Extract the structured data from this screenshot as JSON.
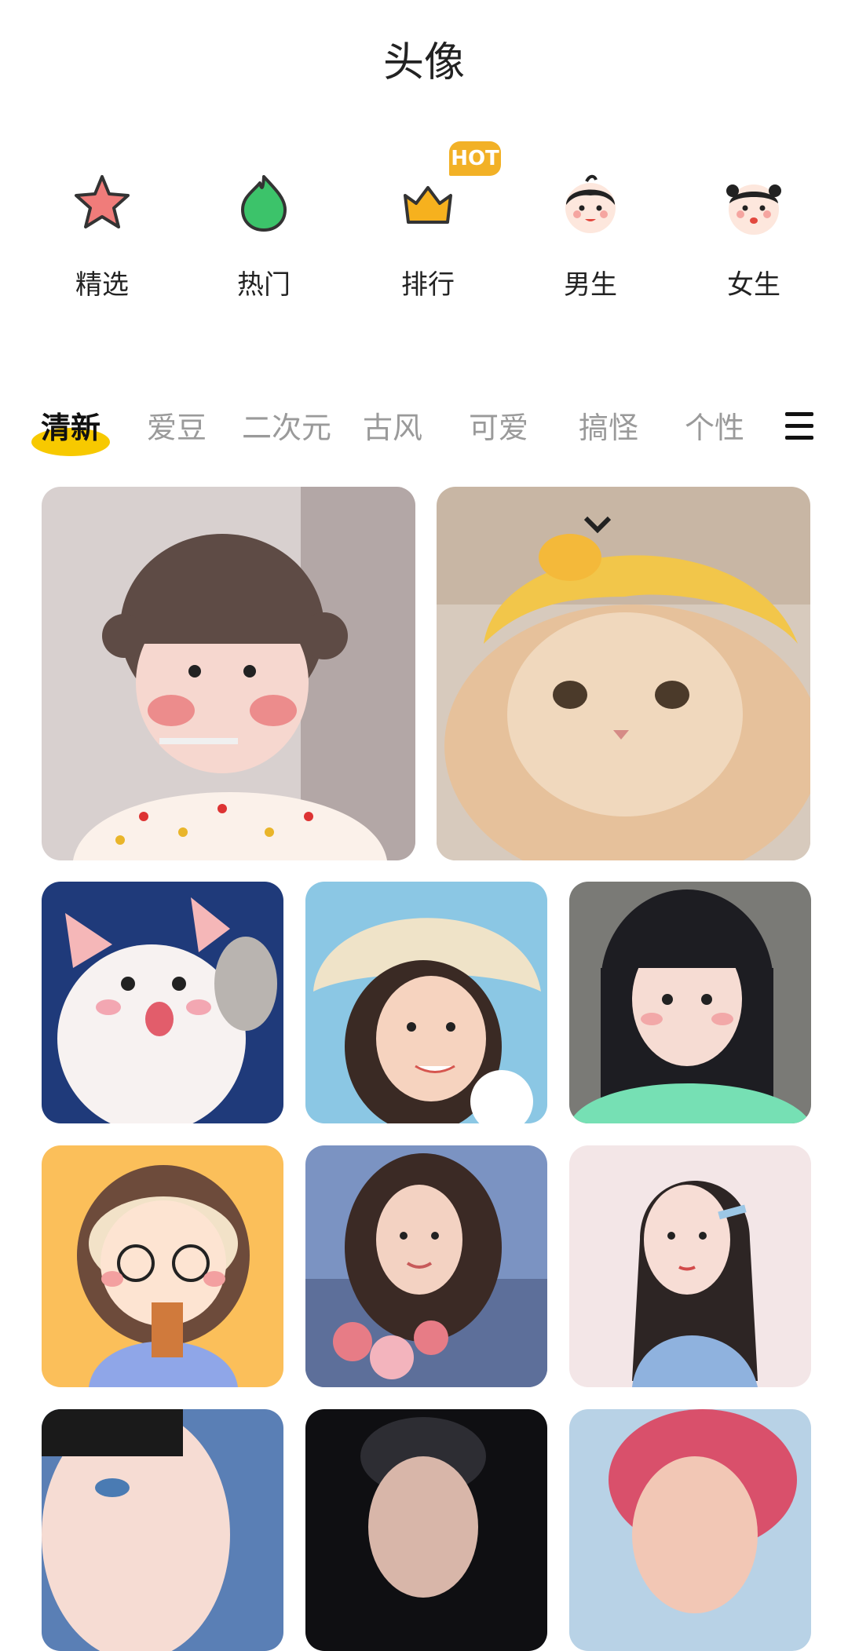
{
  "header": {
    "title": "头像"
  },
  "categories": [
    {
      "label": "精选",
      "icon": "star-icon"
    },
    {
      "label": "热门",
      "icon": "flame-icon"
    },
    {
      "label": "排行",
      "icon": "crown-icon",
      "badge": "HOT"
    },
    {
      "label": "男生",
      "icon": "boy-face-icon"
    },
    {
      "label": "女生",
      "icon": "girl-face-icon"
    }
  ],
  "tabs": [
    {
      "label": "清新",
      "active": true
    },
    {
      "label": "爱豆"
    },
    {
      "label": "二次元"
    },
    {
      "label": "古风"
    },
    {
      "label": "可爱"
    },
    {
      "label": "搞怪"
    },
    {
      "label": "个性"
    }
  ],
  "menu": {
    "icon": "menu-icon"
  },
  "accent": "#f7c900"
}
